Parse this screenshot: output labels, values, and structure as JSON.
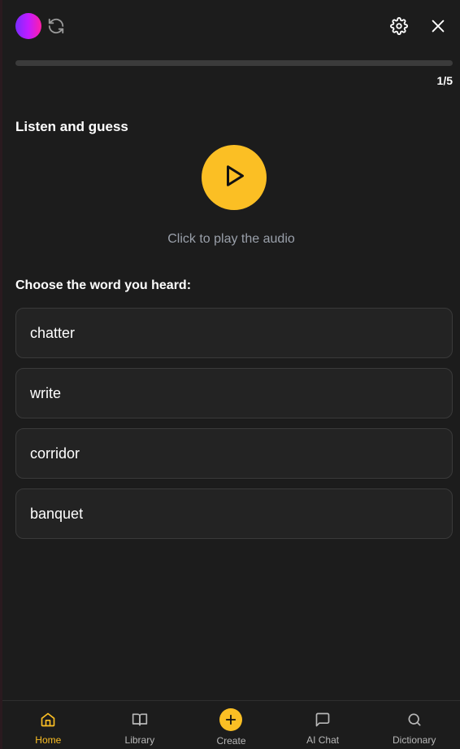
{
  "header": {
    "avatar": "gradient-avatar",
    "icons": [
      "refresh-icon",
      "settings-icon",
      "close-icon"
    ]
  },
  "progress": {
    "current": 1,
    "total": 5,
    "count_text": "1/5"
  },
  "exercise": {
    "title": "Listen and guess",
    "play_hint": "Click to play the audio",
    "question": "Choose the word you heard:",
    "options": [
      "chatter",
      "write",
      "corridor",
      "banquet"
    ]
  },
  "nav": {
    "items": [
      {
        "label": "Home",
        "icon": "home-icon",
        "active": true
      },
      {
        "label": "Library",
        "icon": "book-icon",
        "active": false
      },
      {
        "label": "Create",
        "icon": "plus-icon",
        "active": false
      },
      {
        "label": "AI Chat",
        "icon": "chat-icon",
        "active": false
      },
      {
        "label": "Dictionary",
        "icon": "search-icon",
        "active": false
      }
    ]
  },
  "colors": {
    "accent": "#fbbf24",
    "background": "#1c1c1c",
    "card": "#232323",
    "muted_text": "#9aa0aa"
  }
}
